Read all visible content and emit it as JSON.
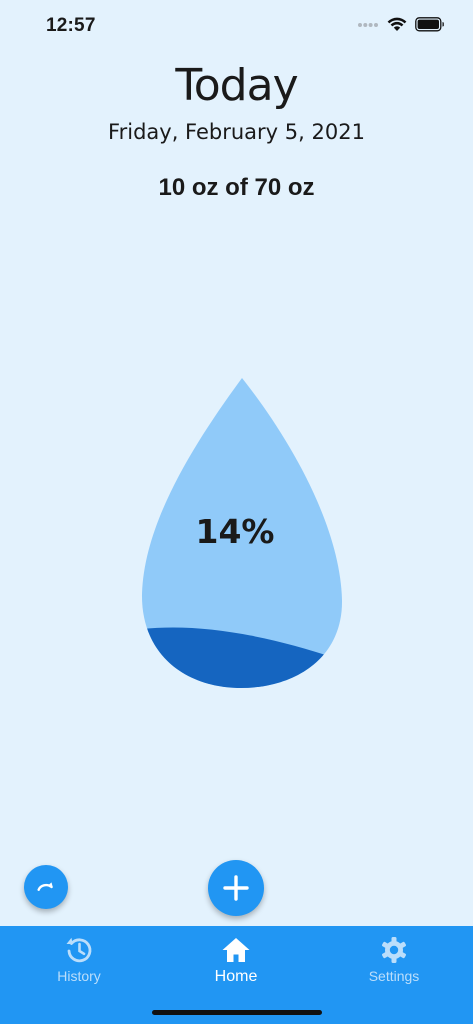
{
  "status_bar": {
    "time": "12:57"
  },
  "header": {
    "title": "Today",
    "date": "Friday, February 5, 2021"
  },
  "intake": {
    "text": "10 oz of 70 oz",
    "current_oz": 10,
    "goal_oz": 70,
    "percent_label": "14%",
    "fill_fraction": 0.14
  },
  "actions": {
    "reset_icon": "redo-arrow-icon",
    "add_icon": "plus-icon"
  },
  "bottom_nav": {
    "items": [
      {
        "label": "History",
        "icon": "history-icon",
        "active": false
      },
      {
        "label": "Home",
        "icon": "home-icon",
        "active": true
      },
      {
        "label": "Settings",
        "icon": "gear-icon",
        "active": false
      }
    ]
  },
  "colors": {
    "background": "#e3f2fd",
    "drop_light": "#90caf9",
    "drop_fill": "#1565c0",
    "accent": "#2196f3"
  }
}
